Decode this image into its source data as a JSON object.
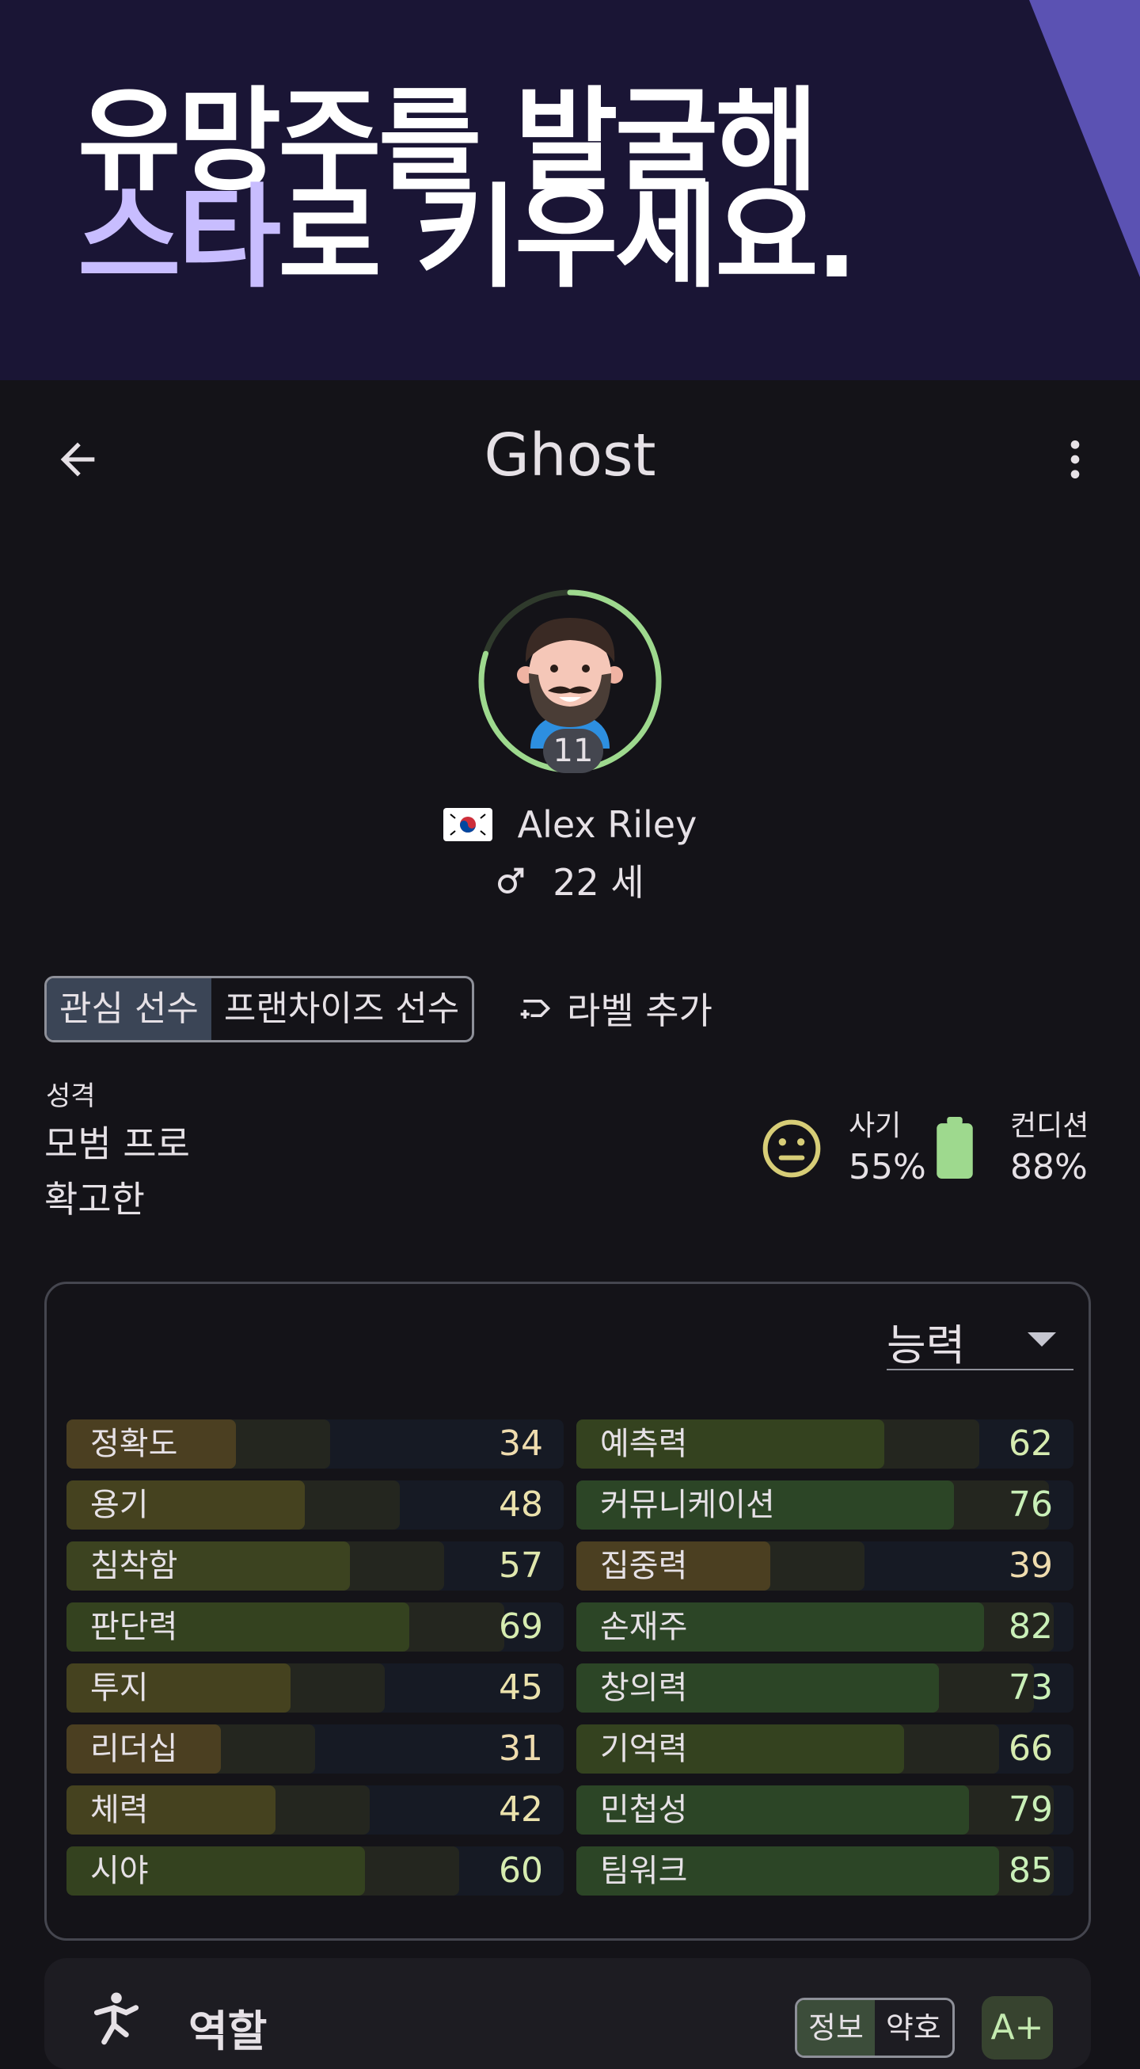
{
  "banner": {
    "headline_line1": "유망주를 발굴해",
    "headline_accent": "스타",
    "headline_rest": "로 키우세요.",
    "colors": {
      "background": "#1a1535",
      "accent": "#c8bdff",
      "shape": "#5b52b3"
    }
  },
  "appbar": {
    "title": "Ghost",
    "back_icon": "arrow-left-icon",
    "more_icon": "more-vertical-icon"
  },
  "profile": {
    "squad_number": "11",
    "flag": "south-korea-flag-icon",
    "name": "Alex Riley",
    "gender_icon": "male-icon",
    "age": "22 세",
    "ring_progress": 0.8
  },
  "labels": {
    "chips": [
      {
        "label": "관심 선수",
        "selected": true
      },
      {
        "label": "프랜차이즈 선수",
        "selected": false
      }
    ],
    "add_label": "라벨 추가"
  },
  "personality": {
    "caption": "성격",
    "line1": "모범 프로",
    "line2": "확고한"
  },
  "status": {
    "morale": {
      "caption": "사기",
      "value": "55%",
      "icon": "neutral-face-icon",
      "color": "#d7cd77"
    },
    "condition": {
      "caption": "컨디션",
      "value": "88%",
      "icon": "battery-icon",
      "color": "#9ed98e"
    }
  },
  "abilities": {
    "dropdown_label": "능력",
    "left": [
      {
        "name": "정확도",
        "value": 34
      },
      {
        "name": "용기",
        "value": 48
      },
      {
        "name": "침착함",
        "value": 57
      },
      {
        "name": "판단력",
        "value": 69
      },
      {
        "name": "투지",
        "value": 45
      },
      {
        "name": "리더십",
        "value": 31
      },
      {
        "name": "체력",
        "value": 42
      },
      {
        "name": "시야",
        "value": 60
      }
    ],
    "right": [
      {
        "name": "예측력",
        "value": 62
      },
      {
        "name": "커뮤니케이션",
        "value": 76
      },
      {
        "name": "집중력",
        "value": 39
      },
      {
        "name": "손재주",
        "value": 82
      },
      {
        "name": "창의력",
        "value": 73
      },
      {
        "name": "기억력",
        "value": 66
      },
      {
        "name": "민첩성",
        "value": 79
      },
      {
        "name": "팀워크",
        "value": 85
      }
    ]
  },
  "bottom_card": {
    "title": "역할",
    "icon": "person-kicking-icon",
    "segments": [
      {
        "label": "정보",
        "selected": true
      },
      {
        "label": "약호",
        "selected": false
      }
    ],
    "grade": "A+"
  }
}
